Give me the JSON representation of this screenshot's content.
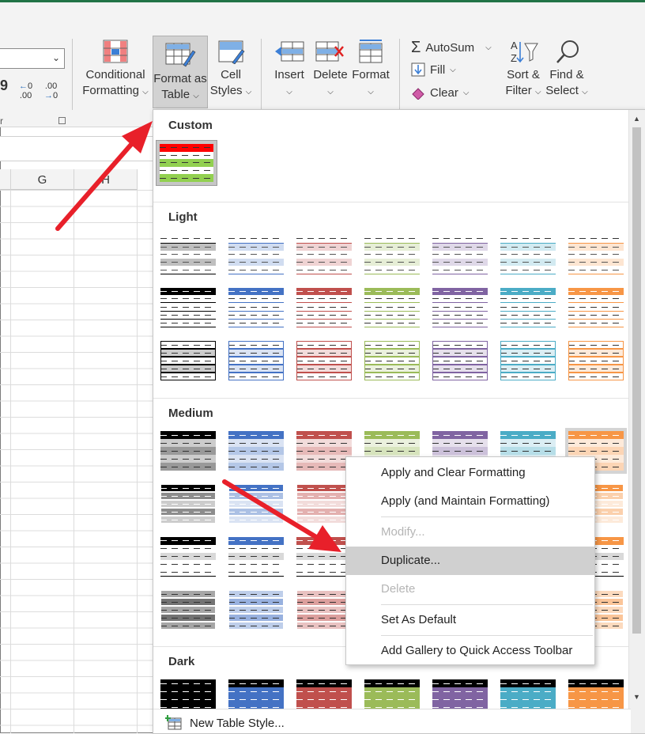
{
  "ribbon": {
    "font_launcher_label": "r",
    "num_increase_label": ".00",
    "num_decrease_label": ".00",
    "num_increase_top": "0",
    "num_decrease_top": ".00",
    "buttons": {
      "conditional_formatting": {
        "line1": "Conditional",
        "line2": "Formatting"
      },
      "format_as_table": {
        "line1": "Format as",
        "line2": "Table"
      },
      "cell_styles": {
        "line1": "Cell",
        "line2": "Styles"
      },
      "insert": "Insert",
      "delete": "Delete",
      "format": "Format",
      "autosum": "AutoSum",
      "fill": "Fill",
      "clear": "Clear",
      "sort_filter": {
        "line1": "Sort &",
        "line2": "Filter"
      },
      "find_select": {
        "line1": "Find &",
        "line2": "Select"
      }
    },
    "sigma_symbol": "Σ"
  },
  "sheet": {
    "columns": [
      "G",
      "H"
    ]
  },
  "gallery": {
    "sections": {
      "custom": "Custom",
      "light": "Light",
      "medium": "Medium",
      "dark": "Dark"
    },
    "footer_label": "New Table Style...",
    "colors": {
      "black": "#000000",
      "blue": "#4472c4",
      "red": "#c0504d",
      "green": "#9bbb59",
      "purple": "#8064a2",
      "aqua": "#4bacc6",
      "orange": "#f79646",
      "custom_red": "#ff0000",
      "custom_green": "#92d050"
    }
  },
  "context_menu": {
    "items": [
      {
        "label": "Apply and Clear Formatting",
        "enabled": true
      },
      {
        "label": "Apply (and Maintain Formatting)",
        "enabled": true
      },
      {
        "label": "Modify...",
        "enabled": false
      },
      {
        "label": "Duplicate...",
        "enabled": true,
        "highlighted": true
      },
      {
        "label": "Delete",
        "enabled": false
      },
      {
        "label": "Set As Default",
        "enabled": true
      },
      {
        "label": "Add Gallery to Quick Access Toolbar",
        "enabled": true
      }
    ]
  },
  "annotations": {
    "arrow_color": "#e8202a"
  }
}
